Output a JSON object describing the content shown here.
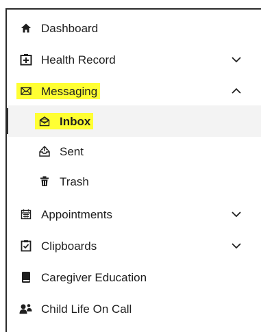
{
  "nav": {
    "dashboard": {
      "label": "Dashboard"
    },
    "health_record": {
      "label": "Health Record"
    },
    "messaging": {
      "label": "Messaging",
      "children": {
        "inbox": {
          "label": "Inbox"
        },
        "sent": {
          "label": "Sent"
        },
        "trash": {
          "label": "Trash"
        }
      }
    },
    "appointments": {
      "label": "Appointments"
    },
    "clipboards": {
      "label": "Clipboards"
    },
    "caregiver_education": {
      "label": "Caregiver Education"
    },
    "child_life": {
      "label": "Child Life On Call"
    }
  },
  "icons": {
    "dashboard": "home-icon",
    "health_record": "medical-kit-icon",
    "messaging": "envelope-icon",
    "inbox": "envelope-open-icon",
    "sent": "outbox-tray-icon",
    "trash": "trash-icon",
    "appointments": "calendar-icon",
    "clipboards": "clipboard-check-icon",
    "caregiver_education": "book-icon",
    "child_life": "user-group-icon"
  },
  "colors": {
    "highlight": "#ffff33",
    "active_background": "#f3f3f3",
    "text": "#1f1f1f",
    "border": "#2b2b2b"
  }
}
